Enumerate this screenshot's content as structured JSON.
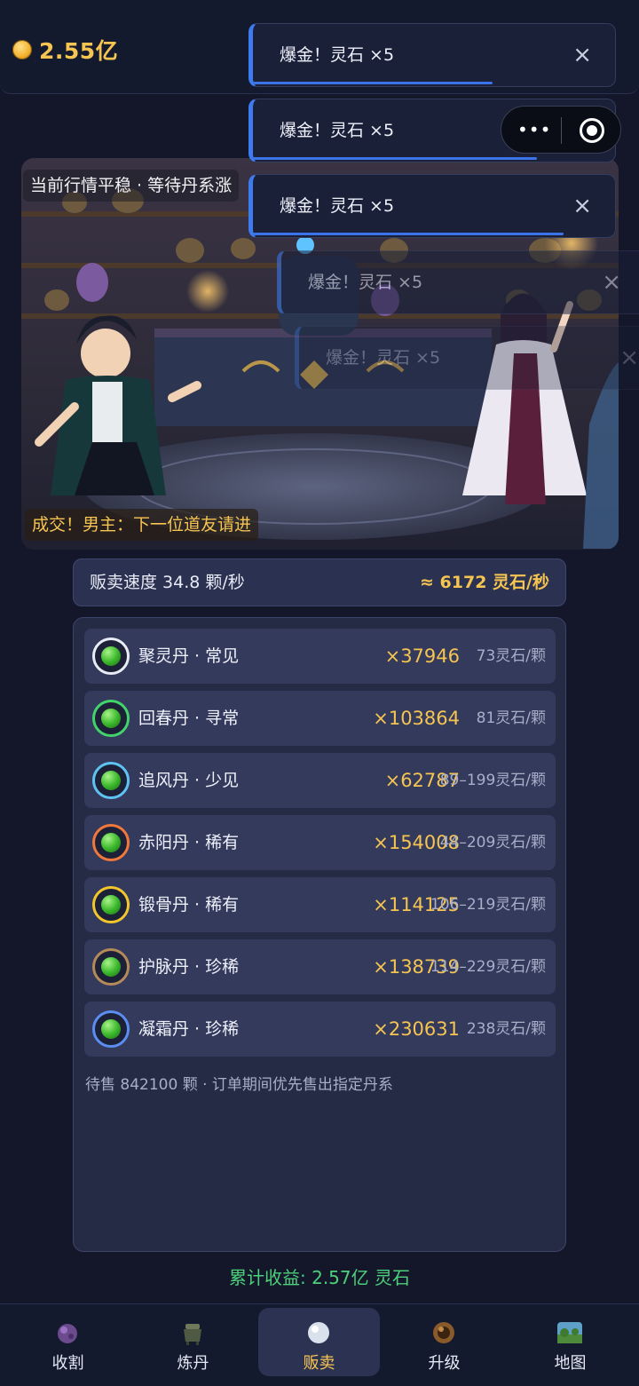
{
  "currency": {
    "icon": "spirit-stone-coin-icon",
    "amount": "2.55亿"
  },
  "toasts": [
    {
      "text": "爆金！灵石 ×5",
      "close": "×"
    },
    {
      "text": "爆金！灵石 ×5",
      "close": "×"
    },
    {
      "text": "爆金！灵石 ×5",
      "close": "×"
    },
    {
      "text": "爆金！灵石 ×5",
      "close": "×"
    },
    {
      "text": "爆金！灵石 ×5",
      "close": "×"
    }
  ],
  "capsule": {
    "more": "•••"
  },
  "scene": {
    "status": "当前行情平稳 · 等待丹系涨",
    "deal": "成交！男主：下一位道友请进"
  },
  "speed": {
    "label": "贩卖速度 34.8 颗/秒",
    "value": "≈ 6172 灵石/秒"
  },
  "pills": [
    {
      "name": "聚灵丹 · 常见",
      "qty": "×37946",
      "price": "73灵石/颗",
      "ring": "#e9ecf5"
    },
    {
      "name": "回春丹 · 寻常",
      "qty": "×103864",
      "price": "81灵石/颗",
      "ring": "#43d36b"
    },
    {
      "name": "追风丹 · 少见",
      "qty": "×62787",
      "price": "89–199灵石/颗",
      "ring": "#5ec3f2"
    },
    {
      "name": "赤阳丹 · 稀有",
      "qty": "×154008",
      "price": "44–209灵石/颗",
      "ring": "#f0783a"
    },
    {
      "name": "锻骨丹 · 稀有",
      "qty": "×114125",
      "price": "106–219灵石/颗",
      "ring": "#f3c62c"
    },
    {
      "name": "护脉丹 · 珍稀",
      "qty": "×138739",
      "price": "114–229灵石/颗",
      "ring": "#b58a5a"
    },
    {
      "name": "凝霜丹 · 珍稀",
      "qty": "×230631",
      "price": "238灵石/颗",
      "ring": "#5a8ef0"
    }
  ],
  "pending_note": "待售 842100 颗 · 订单期间优先售出指定丹系",
  "total_income": "累计收益: 2.57亿 灵石",
  "nav": [
    {
      "label": "收割",
      "icon": "harvest-icon",
      "active": false
    },
    {
      "label": "炼丹",
      "icon": "cauldron-icon",
      "active": false
    },
    {
      "label": "贩卖",
      "icon": "pearl-icon",
      "active": true
    },
    {
      "label": "升级",
      "icon": "upgrade-orb-icon",
      "active": false
    },
    {
      "label": "地图",
      "icon": "map-icon",
      "active": false
    }
  ],
  "colors": {
    "accent": "#f6c451",
    "toast_border": "#3f7bf0",
    "income_green": "#4dd07b"
  }
}
